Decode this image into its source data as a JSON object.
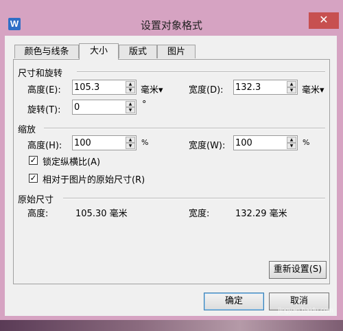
{
  "window": {
    "app_icon": "W",
    "title": "设置对象格式",
    "close_glyph": "✕"
  },
  "tabs": [
    {
      "label": "颜色与线条",
      "active": false
    },
    {
      "label": "大小",
      "active": true
    },
    {
      "label": "版式",
      "active": false
    },
    {
      "label": "图片",
      "active": false
    }
  ],
  "size_rotate": {
    "title": "尺寸和旋转",
    "height_label": "高度(E):",
    "height_value": "105.3",
    "height_unit": "毫米▾",
    "width_label": "宽度(D):",
    "width_value": "132.3",
    "width_unit": "毫米▾",
    "rotate_label": "旋转(T):",
    "rotate_value": "0",
    "rotate_unit": "°"
  },
  "scale": {
    "title": "缩放",
    "height_label": "高度(H):",
    "height_value": "100",
    "height_unit": "%",
    "width_label": "宽度(W):",
    "width_value": "100",
    "width_unit": "%",
    "lock_ratio_label": "锁定纵横比(A)",
    "lock_ratio_checked": "✓",
    "relative_label": "相对于图片的原始尺寸(R)",
    "relative_checked": "✓"
  },
  "original": {
    "title": "原始尺寸",
    "height_label": "高度:",
    "height_value": "105.30 毫米",
    "width_label": "宽度:",
    "width_value": "132.29 毫米"
  },
  "buttons": {
    "reset": "重新设置(S)",
    "ok": "确定",
    "cancel": "取消"
  },
  "watermark": "jingyan.baidu.com",
  "colors": {
    "window_frame": "#d6a3c2",
    "close_button": "#c75050",
    "client_bg": "#f0f0f0"
  }
}
